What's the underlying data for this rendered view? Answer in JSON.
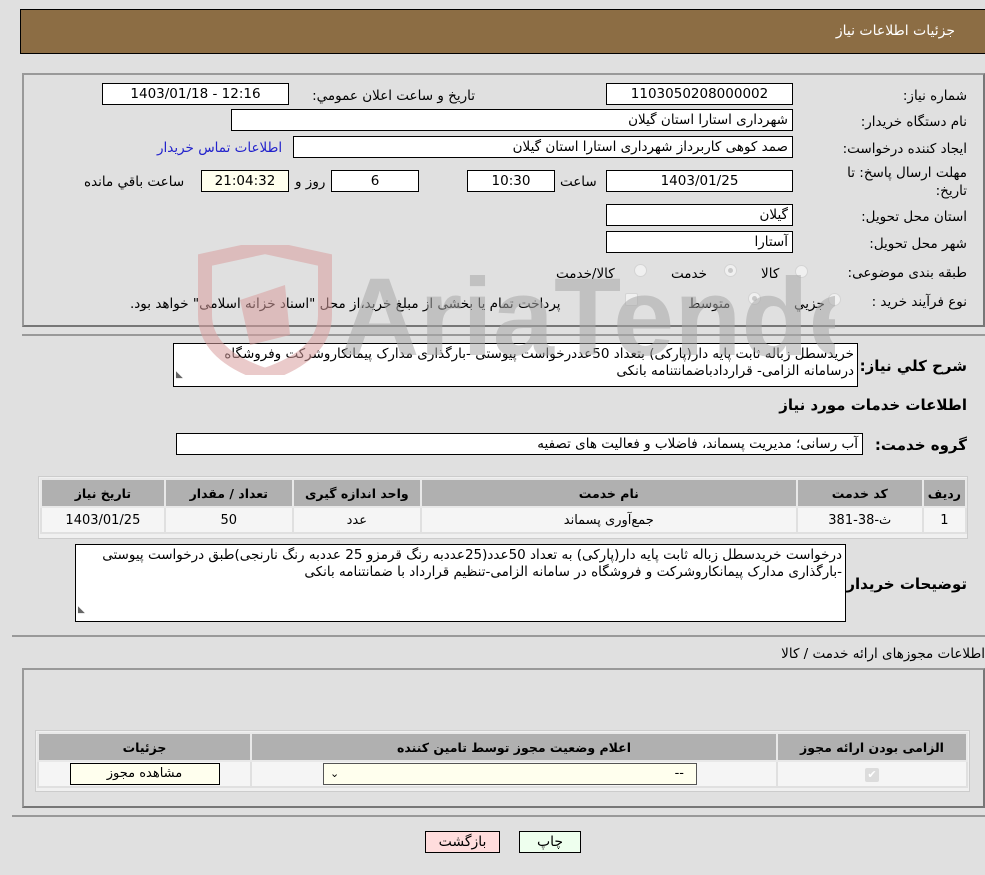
{
  "header": {
    "title": "جزئیات اطلاعات نیاز"
  },
  "form": {
    "need_number": {
      "label": "شماره نیاز:",
      "value": "1103050208000002"
    },
    "announce_datetime": {
      "label": "تاریخ و ساعت اعلان عمومي:",
      "value": "1403/01/18 - 12:16"
    },
    "buyer_org": {
      "label": "نام دستگاه خريدار:",
      "value": "شهرداری استارا استان گیلان"
    },
    "requester": {
      "label": "ايجاد کننده درخواست:",
      "value": "صمد کوهی کاربرداز شهرداری استارا استان گیلان"
    },
    "buyer_contact_link": "اطلاعات تماس خريدار",
    "deadline": {
      "label": "مهلت ارسال پاسخ: تا تاریخ:",
      "date": "1403/01/25",
      "time_label": "ساعت",
      "time": "10:30",
      "days": "6",
      "days_label": "روز و",
      "remaining": "21:04:32",
      "remaining_label": "ساعت باقي مانده"
    },
    "delivery_province": {
      "label": "استان محل تحويل:",
      "value": "گیلان"
    },
    "delivery_city": {
      "label": "شهر محل تحويل:",
      "value": "آستارا"
    },
    "category": {
      "label": "طبقه بندی موضوعی:",
      "options": [
        "کالا",
        "خدمت",
        "کالا/خدمت"
      ],
      "selected": "خدمت"
    },
    "purchase_type": {
      "label": "نوع فرآیند خرید :",
      "options": [
        "جزيي",
        "متوسط"
      ],
      "selected": "متوسط",
      "treasury_note": "پرداخت تمام یا بخشی از مبلغ خرید،از محل \"اسناد خزانه اسلامی\" خواهد بود."
    }
  },
  "summary": {
    "label": "شرح کلي نياز:",
    "text": "خریدسطل زباله ثابت پایه دار(پارکی) بتعداد 50عددرخواست پیوستی -بارگذاری مدارک پیمانکاروشرکت وفروشگاه درسامانه الزامی- قراردادباضمانتنامه بانکی"
  },
  "services": {
    "section_title": "اطلاعات خدمات مورد نياز",
    "group_label": "گروه خدمت:",
    "group_value": "آب رسانی؛ مدیریت پسماند، فاضلاب و فعالیت های تصفیه",
    "table": {
      "headers": [
        "رديف",
        "کد خدمت",
        "نام خدمت",
        "واحد اندازه گيری",
        "تعداد / مقدار",
        "تاريخ نياز"
      ],
      "rows": [
        [
          "1",
          "ث-38-381",
          "جمع‌آوری پسماند",
          "عدد",
          "50",
          "1403/01/25"
        ]
      ]
    }
  },
  "buyer_notes": {
    "label": "توضيحات خريدار:",
    "text": "درخواست خریدسطل زباله ثابت پایه دار(پارکی) به تعداد 50عدد(25عددبه رنگ قرمزو 25 عددبه رنگ نارنجی)طبق درخواست پیوستی -بارگذاری مدارک پیمانکاروشرکت و فروشگاه در سامانه الزامی-تنظیم قرارداد با ضمانتنامه بانکی"
  },
  "permits": {
    "section_title": "اطلاعات مجوزهای ارائه خدمت / کالا",
    "headers": [
      "الزامی بودن ارائه مجوز",
      "اعلام وضعیت مجوز توسط تامین کننده",
      "جزئیات"
    ],
    "row": {
      "required_checked": true,
      "status_select": "--",
      "view_button": "مشاهده مجوز"
    }
  },
  "buttons": {
    "print": "چاپ",
    "back": "بازگشت"
  },
  "watermark": "AriaTender.neT"
}
